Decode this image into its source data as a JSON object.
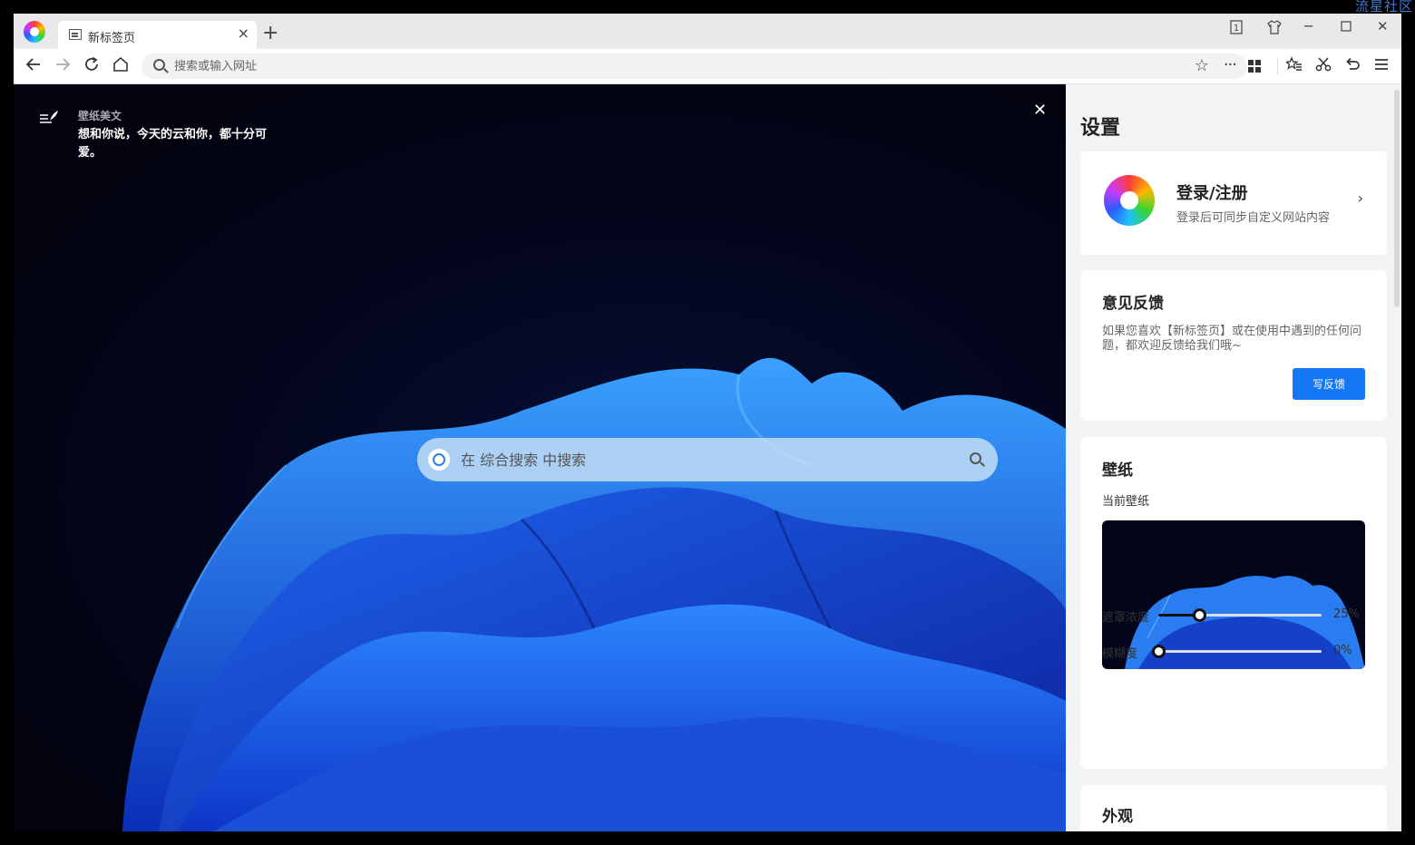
{
  "watermark": "流星社区",
  "tab": {
    "title": "新标签页"
  },
  "toolbar": {
    "address_placeholder": "搜索或输入网址"
  },
  "wallpaper": {
    "quote_heading": "壁纸美文",
    "quote_text": "想和你说，今天的云和你，都十分可爱。"
  },
  "search": {
    "placeholder": "在 综合搜索 中搜索"
  },
  "settings": {
    "title": "设置",
    "login": {
      "title": "登录/注册",
      "subtitle": "登录后可同步自定义网站内容"
    },
    "feedback": {
      "title": "意见反馈",
      "description": "如果您喜欢【新标签页】或在使用中遇到的任何问题，都欢迎反馈给我们哦~",
      "button": "写反馈"
    },
    "wallpaper": {
      "title": "壁纸",
      "current_label": "当前壁纸",
      "mask": {
        "label": "遮罩浓度",
        "value": "25%",
        "fraction": 0.25
      },
      "blur": {
        "label": "模糊度",
        "value": "0%",
        "fraction": 0
      }
    },
    "appearance": {
      "title": "外观"
    }
  },
  "icons": {
    "tab_close": "close-icon",
    "new_tab": "plus-icon",
    "back": "arrow-left-icon",
    "forward": "arrow-right-icon",
    "reload": "reload-icon",
    "home": "home-icon",
    "bookmark": "star-icon",
    "more": "more-icon",
    "apps": "grid-icon",
    "favorites": "favorites-icon",
    "screenshot": "scissors-icon",
    "undo": "undo-icon",
    "menu": "hamburger-menu-icon"
  },
  "colors": {
    "accent": "#1677f5",
    "wallpaper_blue": "#1a4fd8"
  }
}
